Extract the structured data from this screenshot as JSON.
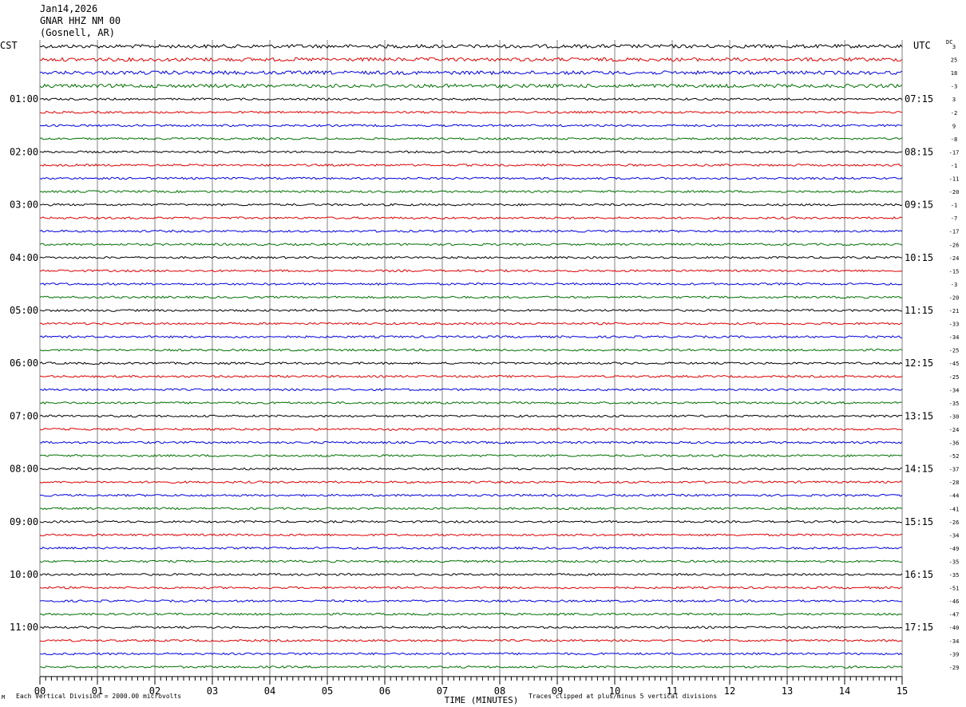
{
  "header": {
    "date": "Jan14,2026",
    "station": "GNAR HHZ NM 00",
    "location": "(Gosnell, AR)"
  },
  "left_timezone": "CST",
  "right_timezone": "UTC",
  "dc_label": "DC",
  "footer": {
    "scale_note": "Each Vertical Division = 2000.00 microvolts",
    "clip_note": "Traces clipped at plus/minus 5 vertical divisions",
    "corner_mark": "M"
  },
  "chart_data": {
    "type": "line",
    "title": "",
    "xlabel": "TIME (MINUTES)",
    "ylabel": "",
    "xlim": [
      0,
      15
    ],
    "x_ticks": [
      "00",
      "01",
      "02",
      "03",
      "04",
      "05",
      "06",
      "07",
      "08",
      "09",
      "10",
      "11",
      "12",
      "13",
      "14",
      "15"
    ],
    "left_hour_labels": [
      "01:00",
      "02:00",
      "03:00",
      "04:00",
      "05:00",
      "06:00",
      "07:00",
      "08:00",
      "09:00",
      "10:00",
      "11:00"
    ],
    "right_hour_labels": [
      "07:15",
      "08:15",
      "09:15",
      "10:15",
      "11:15",
      "12:15",
      "13:15",
      "14:15",
      "15:15",
      "16:15",
      "17:15"
    ],
    "trace_colors": [
      "#000000",
      "#e00000",
      "#0000e0",
      "#007000"
    ],
    "trace_count": 48,
    "dc_offsets": [
      "3",
      "25",
      "18",
      "-3",
      "3",
      "-2",
      "9",
      "-8",
      "-17",
      "-1",
      "-11",
      "-20",
      "-1",
      "-7",
      "-17",
      "-26",
      "-24",
      "-15",
      "-3",
      "-20",
      "-21",
      "-33",
      "-34",
      "-25",
      "-45",
      "-25",
      "-34",
      "-35",
      "-30",
      "-24",
      "-36",
      "-52",
      "-37",
      "-28",
      "-44",
      "-41",
      "-26",
      "-34",
      "-49",
      "-35",
      "-35",
      "-51",
      "-46",
      "-47",
      "-40",
      "-34",
      "-39",
      "-29"
    ],
    "grid": true
  }
}
